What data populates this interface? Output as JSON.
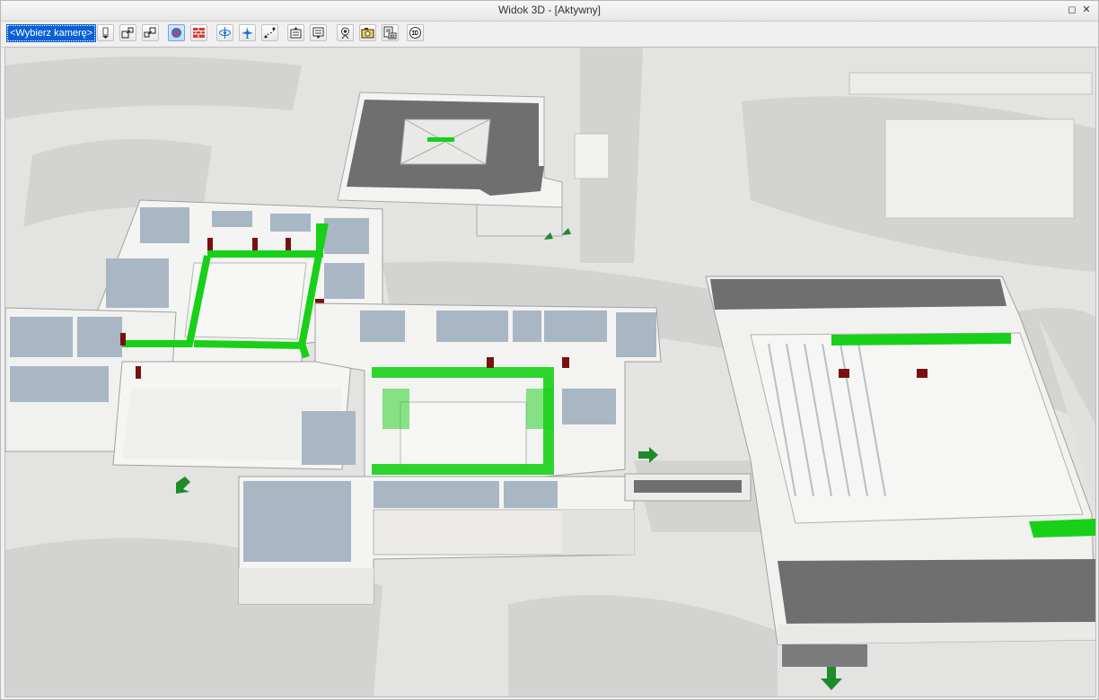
{
  "window": {
    "title": "Widok 3D - [Aktywny]",
    "restore_glyph": "◻",
    "close_glyph": "✕"
  },
  "toolbar": {
    "camera_select": "<Wybierz kamerę>",
    "buttons": [
      {
        "icon": "camera-dropdown-icon"
      },
      {
        "icon": "zoom-window-in-icon"
      },
      {
        "icon": "zoom-window-out-icon"
      },
      {
        "icon": "render-mode-icon"
      },
      {
        "icon": "wall-brick-icon"
      },
      {
        "icon": "orbit-rotate-icon"
      },
      {
        "icon": "fly-mode-icon"
      },
      {
        "icon": "walk-path-icon"
      },
      {
        "icon": "floor-up-icon"
      },
      {
        "icon": "floor-down-icon"
      },
      {
        "icon": "camera-settings-icon"
      },
      {
        "icon": "photo-capture-icon"
      },
      {
        "icon": "export-3d-icon"
      },
      {
        "icon": "view-3d-icon"
      }
    ]
  },
  "viewport": {
    "type": "3d-building-model",
    "colors": {
      "ground": "#e3e3e1",
      "path": "#cfcfcd",
      "roof": "#6e6e6e",
      "floor": "#a9b6c4",
      "escape_route": "#18d018",
      "door": "#7a1010",
      "exit_arrow": "#1f8a2a"
    }
  }
}
